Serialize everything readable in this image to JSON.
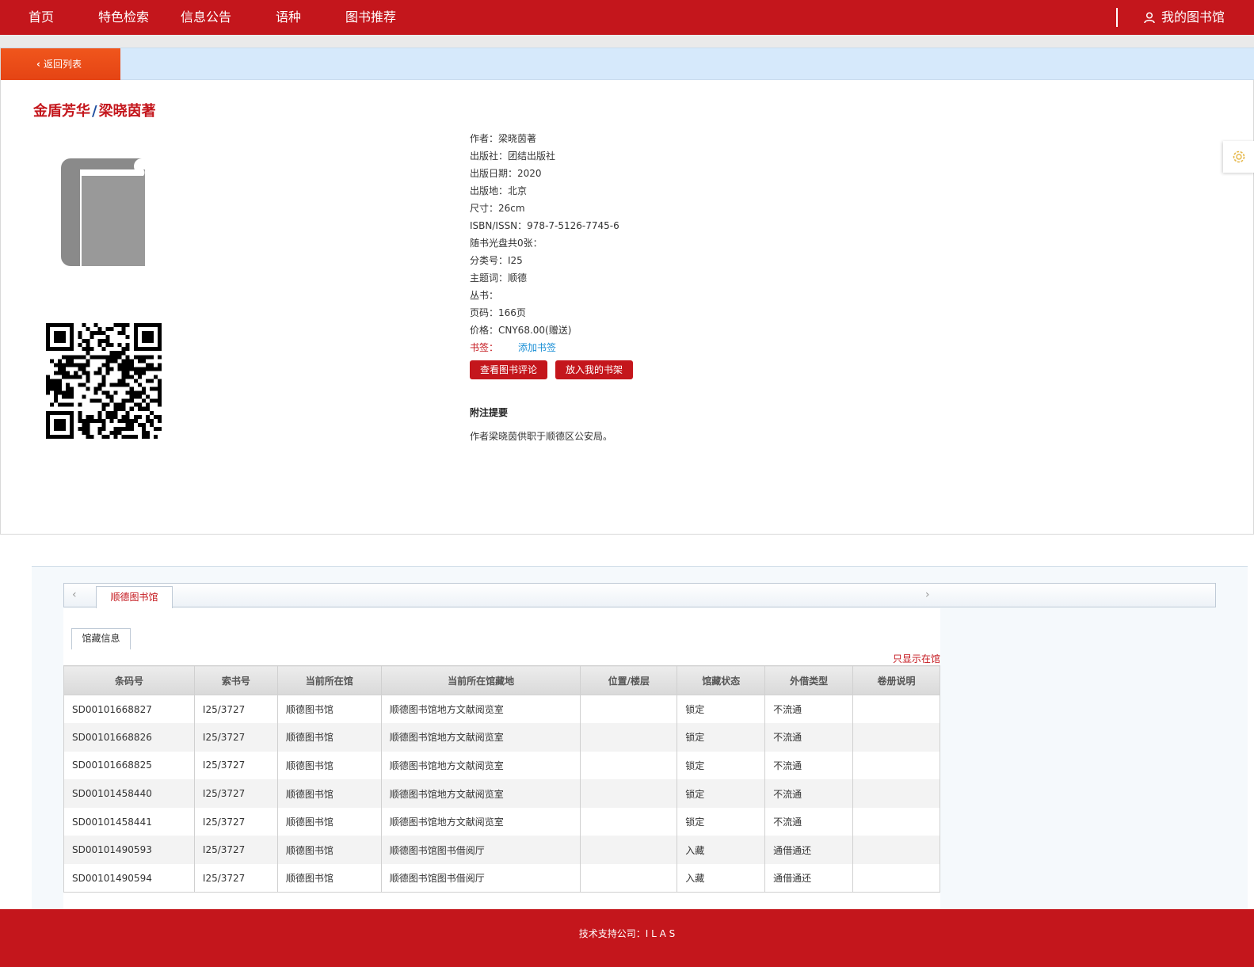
{
  "nav": {
    "items": [
      {
        "label": "首页"
      },
      {
        "label": "特色检索"
      },
      {
        "label": "信息公告"
      },
      {
        "label": "语种"
      },
      {
        "label": "图书推荐"
      }
    ],
    "my_library": "我的图书馆"
  },
  "back_label": "返回列表",
  "book": {
    "title_main": "金盾芳华",
    "title_sep": "/",
    "title_author": "梁晓茵著",
    "meta": [
      "作者：梁晓茵著",
      "出版社：团结出版社",
      "出版日期：2020",
      "出版地：北京",
      "尺寸：26cm",
      "ISBN/ISSN：978-7-5126-7745-6",
      "随书光盘共0张：",
      "分类号：I25",
      "主题词：顺德",
      "丛书：",
      "页码：166页",
      "价格：CNY68.00(赠送)"
    ],
    "bookmark_label": "书签：",
    "bookmark_link": "添加书签",
    "btn_reviews": "查看图书评论",
    "btn_shelf": "放入我的书架",
    "abstract_title": "附注提要",
    "abstract_text": "作者梁晓茵供职于顺德区公安局。"
  },
  "holdings": {
    "library_tab": "顺德图书馆",
    "subtab": "馆藏信息",
    "only_in_library": "只显示在馆",
    "columns": [
      "条码号",
      "索书号",
      "当前所在馆",
      "当前所在馆藏地",
      "位置/楼层",
      "馆藏状态",
      "外借类型",
      "卷册说明"
    ],
    "rows": [
      [
        "SD00101668827",
        "I25/3727",
        "顺德图书馆",
        "顺德图书馆地方文献阅览室",
        "",
        "锁定",
        "不流通",
        ""
      ],
      [
        "SD00101668826",
        "I25/3727",
        "顺德图书馆",
        "顺德图书馆地方文献阅览室",
        "",
        "锁定",
        "不流通",
        ""
      ],
      [
        "SD00101668825",
        "I25/3727",
        "顺德图书馆",
        "顺德图书馆地方文献阅览室",
        "",
        "锁定",
        "不流通",
        ""
      ],
      [
        "SD00101458440",
        "I25/3727",
        "顺德图书馆",
        "顺德图书馆地方文献阅览室",
        "",
        "锁定",
        "不流通",
        ""
      ],
      [
        "SD00101458441",
        "I25/3727",
        "顺德图书馆",
        "顺德图书馆地方文献阅览室",
        "",
        "锁定",
        "不流通",
        ""
      ],
      [
        "SD00101490593",
        "I25/3727",
        "顺德图书馆",
        "顺德图书馆图书借阅厅",
        "",
        "入藏",
        "通借通还",
        ""
      ],
      [
        "SD00101490594",
        "I25/3727",
        "顺德图书馆",
        "顺德图书馆图书借阅厅",
        "",
        "入藏",
        "通借通还",
        ""
      ]
    ]
  },
  "footer_text": "技术支持公司：I L A S",
  "colors": {
    "brand_red": "#c4161c",
    "back_orange": "#e54414",
    "link_blue": "#1a8fd6"
  }
}
